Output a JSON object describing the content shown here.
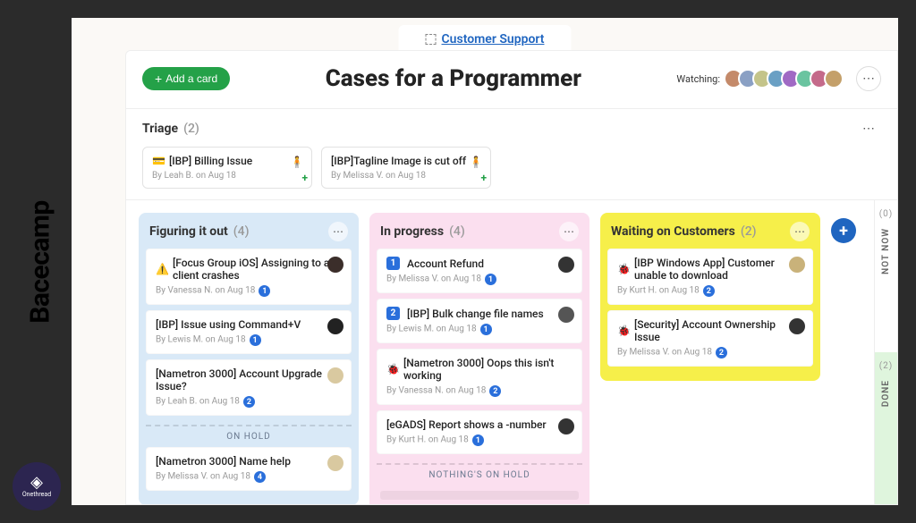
{
  "side_label": "Bacecamp",
  "logo_text": "Onethread",
  "breadcrumb": {
    "label": "Customer Support"
  },
  "header": {
    "add_card": "Add a card",
    "title": "Cases for a Programmer",
    "watching_label": "Watching:"
  },
  "triage": {
    "title": "Triage",
    "count": "(2)",
    "cards": [
      {
        "icon": "💳",
        "title": "[IBP] Billing Issue",
        "meta": "By Leah B. on Aug 18"
      },
      {
        "icon": "",
        "title": "[IBP]Tagline Image is cut off",
        "meta": "By Melissa V. on Aug 18"
      }
    ]
  },
  "columns": [
    {
      "color": "blue",
      "title": "Figuring it out",
      "count": "(4)",
      "cards": [
        {
          "icon": "⚠️",
          "title": "[Focus Group iOS] Assigning to a client crashes",
          "meta": "By Vanessa N. on Aug 18",
          "badge": "1",
          "avatar": "p1"
        },
        {
          "icon": "",
          "title": "[IBP] Issue using Command+V",
          "meta": "By Lewis M. on Aug 18",
          "badge": "1",
          "avatar": "p2"
        },
        {
          "icon": "",
          "title": "[Nametron 3000] Account Upgrade Issue?",
          "meta": "By Leah B. on Aug 18",
          "badge": "2",
          "avatar": "p3"
        }
      ],
      "hold_label": "ON HOLD",
      "hold_cards": [
        {
          "icon": "",
          "title": "[Nametron 3000] Name help",
          "meta": "By Melissa V. on Aug 18",
          "badge": "4",
          "avatar": "p3"
        }
      ]
    },
    {
      "color": "pink",
      "title": "In progress",
      "count": "(4)",
      "cards": [
        {
          "num": "1",
          "title": "Account Refund",
          "meta": "By Melissa V. on Aug 18",
          "badge": "1",
          "avatar": "p4"
        },
        {
          "num": "2",
          "title": "[IBP] Bulk change file names",
          "meta": "By Lewis M. on Aug 18",
          "badge": "1",
          "avatar": "p5"
        },
        {
          "icon": "🐞",
          "title": "[Nametron 3000] Oops this isn't working",
          "meta": "By Vanessa N. on Aug 18",
          "badge": "2",
          "avatar": ""
        },
        {
          "icon": "",
          "title": "[eGADS] Report shows a -number",
          "meta": "By Kurt H. on Aug 18",
          "badge": "1",
          "avatar": "p4"
        }
      ],
      "nothing_hold": "NOTHING'S ON HOLD"
    },
    {
      "color": "yellow",
      "title": "Waiting on Customers",
      "count": "(2)",
      "cards": [
        {
          "icon": "🐞",
          "title": "[IBP Windows App] Customer unable to download",
          "meta": "By Kurt H. on Aug 18",
          "badge": "2",
          "avatar": "p6"
        },
        {
          "icon": "🐞",
          "title": "[Security] Account Ownership Issue",
          "meta": "By Melissa V. on Aug 18",
          "badge": "2",
          "avatar": "p4"
        }
      ]
    }
  ],
  "rails": {
    "not_now": {
      "label": "NOT NOW",
      "count": "(0)"
    },
    "done": {
      "label": "DONE",
      "count": "(2)"
    }
  }
}
